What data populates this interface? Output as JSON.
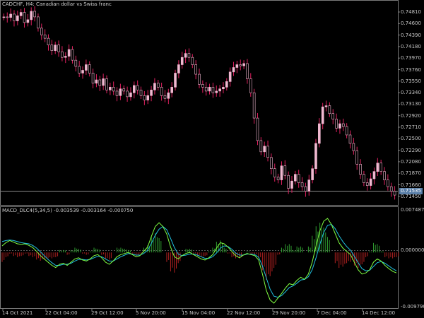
{
  "chart_window": {
    "title": "CADCHF, H4: Canadian dollar vs Swiss franc",
    "indicator_title": "MACD_DLC4(5,34,5) -0.003539 -0.003164 -0.000750"
  },
  "price_axis": {
    "labels": [
      "0.74810",
      "0.74600",
      "0.74390",
      "0.74180",
      "0.73970",
      "0.73760",
      "0.73550",
      "0.73340",
      "0.73130",
      "0.72920",
      "0.72710",
      "0.72500",
      "0.72290",
      "0.72080",
      "0.71870",
      "0.71660",
      "0.71450"
    ],
    "current_price": "0.71535"
  },
  "indicator_axis": {
    "labels": [
      "0.007487",
      "0.000000",
      "-0.009790"
    ]
  },
  "time_axis": {
    "labels": [
      "14 Oct 2021",
      "22 Oct 04:00",
      "29 Oct 12:00",
      "5 Nov 20:00",
      "15 Nov 04:00",
      "22 Nov 12:00",
      "29 Nov 20:00",
      "7 Dec 04:00",
      "14 Dec 12:00"
    ]
  },
  "colors": {
    "background": "#000000",
    "candle": "#f0b8d0",
    "wick": "#e02060",
    "macd_line": "#80ff40",
    "signal_line": "#20c0e0",
    "hist_up": "#2e9a2e",
    "hist_down": "#b02020",
    "grid_line": "#7a7a7a"
  },
  "chart_data": {
    "type": "line",
    "price_series": [
      0.747,
      0.7469,
      0.7475,
      0.7463,
      0.7472,
      0.7478,
      0.746,
      0.7465,
      0.748,
      0.747,
      0.745,
      0.7438,
      0.7432,
      0.742,
      0.741,
      0.742,
      0.7408,
      0.7398,
      0.74,
      0.7412,
      0.7393,
      0.7382,
      0.737,
      0.7375,
      0.7385,
      0.737,
      0.7352,
      0.7358,
      0.7348,
      0.736,
      0.734,
      0.7345,
      0.7338,
      0.733,
      0.7342,
      0.7338,
      0.7328,
      0.7335,
      0.7348,
      0.734,
      0.733,
      0.7322,
      0.733,
      0.734,
      0.7352,
      0.7345,
      0.733,
      0.7325,
      0.7335,
      0.7345,
      0.737,
      0.7385,
      0.7398,
      0.7405,
      0.7398,
      0.7385,
      0.7368,
      0.735,
      0.7345,
      0.7338,
      0.7345,
      0.7335,
      0.7338,
      0.7342,
      0.7345,
      0.7355,
      0.7372,
      0.738,
      0.7385,
      0.7383,
      0.7387,
      0.736,
      0.7335,
      0.729,
      0.725,
      0.723,
      0.724,
      0.722,
      0.72,
      0.7185,
      0.718,
      0.7205,
      0.7188,
      0.7165,
      0.7178,
      0.719,
      0.7175,
      0.7168,
      0.716,
      0.718,
      0.72,
      0.7245,
      0.728,
      0.731,
      0.7312,
      0.7298,
      0.7288,
      0.7272,
      0.728,
      0.7275,
      0.726,
      0.7245,
      0.7232,
      0.7208,
      0.719,
      0.7175,
      0.717,
      0.7182,
      0.7195,
      0.721,
      0.7195,
      0.718,
      0.7168,
      0.716,
      0.7153
    ],
    "macd_series": [
      0.0012,
      0.0018,
      0.0022,
      0.0019,
      0.0016,
      0.0015,
      0.0016,
      0.0013,
      0.0009,
      0.0002,
      -0.0006,
      -0.0012,
      -0.0018,
      -0.0024,
      -0.0028,
      -0.0022,
      -0.002,
      -0.0024,
      -0.0018,
      -0.0012,
      -0.001,
      -0.0014,
      -0.0016,
      -0.0012,
      -0.0006,
      -0.0004,
      -0.001,
      -0.0018,
      -0.0022,
      -0.0016,
      -0.0008,
      -0.0004,
      -0.0002,
      0.0,
      -0.0004,
      -0.0008,
      -0.0006,
      0.0002,
      0.001,
      0.003,
      0.0048,
      0.0055,
      0.0048,
      0.0034,
      0.001,
      -0.0008,
      -0.0012,
      -0.0006,
      -0.0002,
      0.0,
      -0.0004,
      -0.0008,
      -0.0012,
      -0.0014,
      -0.001,
      -0.0004,
      0.0008,
      0.0018,
      0.0016,
      0.001,
      0.0002,
      -0.0006,
      -0.001,
      -0.0005,
      -0.0002,
      -0.0004,
      -0.0006,
      -0.0014,
      -0.004,
      -0.007,
      -0.0088,
      -0.0094,
      -0.0085,
      -0.0076,
      -0.0066,
      -0.0058,
      -0.006,
      -0.0052,
      -0.0046,
      -0.005,
      -0.004,
      -0.0018,
      0.0012,
      0.004,
      0.0058,
      0.0063,
      0.0052,
      0.0035,
      0.0018,
      0.0008,
      0.0002,
      -0.0004,
      -0.0018,
      -0.0032,
      -0.004,
      -0.0038,
      -0.0032,
      -0.0018,
      -0.0012,
      -0.0016,
      -0.0024,
      -0.003,
      -0.0035,
      -0.0038
    ],
    "signal_series": [
      0.002,
      0.0022,
      0.0023,
      0.0022,
      0.002,
      0.0018,
      0.0017,
      0.0016,
      0.0013,
      0.0008,
      0.0001,
      -0.0006,
      -0.0013,
      -0.0019,
      -0.0024,
      -0.0024,
      -0.0022,
      -0.0022,
      -0.002,
      -0.0016,
      -0.0013,
      -0.0013,
      -0.0014,
      -0.0013,
      -0.001,
      -0.0007,
      -0.0008,
      -0.0012,
      -0.0016,
      -0.0016,
      -0.0012,
      -0.0008,
      -0.0005,
      -0.0002,
      -0.0003,
      -0.0005,
      -0.0005,
      -0.0002,
      0.0004,
      0.0017,
      0.0032,
      0.0043,
      0.0048,
      0.0042,
      0.0026,
      0.0009,
      -0.0003,
      -0.0006,
      -0.0005,
      -0.0003,
      -0.0003,
      -0.0005,
      -0.0008,
      -0.0011,
      -0.0011,
      -0.0008,
      -0.0001,
      0.0008,
      0.0012,
      0.0011,
      0.0006,
      -0.0001,
      -0.0005,
      -0.0005,
      -0.0003,
      -0.0003,
      -0.0004,
      -0.0009,
      -0.0025,
      -0.0047,
      -0.0068,
      -0.0081,
      -0.0083,
      -0.008,
      -0.0073,
      -0.0065,
      -0.0062,
      -0.0057,
      -0.0051,
      -0.005,
      -0.0045,
      -0.0032,
      -0.001,
      0.0015,
      0.0037,
      0.005,
      0.0052,
      0.0044,
      0.0031,
      0.002,
      0.0011,
      0.0004,
      -0.0007,
      -0.0019,
      -0.003,
      -0.0034,
      -0.0033,
      -0.0026,
      -0.0019,
      -0.0017,
      -0.002,
      -0.0025,
      -0.003,
      -0.0034
    ],
    "price_range": [
      0.7138,
      0.749
    ],
    "indicator_range": [
      -0.00979,
      0.007487
    ],
    "grid": false
  }
}
